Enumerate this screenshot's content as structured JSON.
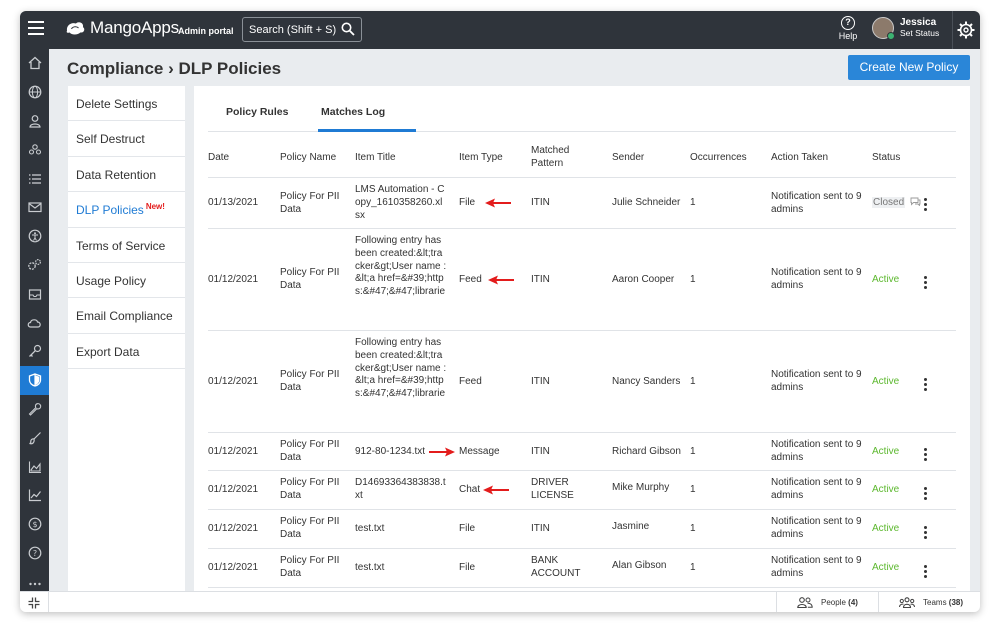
{
  "topbar": {
    "brand": "MangoApps",
    "portal_label": "Admin portal",
    "search_placeholder": "Search (Shift + S)",
    "help_label": "Help",
    "user_name": "Jessica",
    "user_status": "Set Status"
  },
  "rail": {
    "icons": [
      "home-icon",
      "globe-icon",
      "user-icon",
      "group-icon",
      "list-icon",
      "mail-icon",
      "accessibility-icon",
      "gears-icon",
      "inbox-icon",
      "cloud-icon",
      "key-icon",
      "shield-icon",
      "wrench-icon",
      "brush-icon",
      "chart-area-icon",
      "trend-icon",
      "dollar-icon",
      "help-circle-icon",
      "more-icon"
    ],
    "active_index": 11
  },
  "page": {
    "title": "Compliance › DLP Policies",
    "create_button": "Create New Policy"
  },
  "left_menu": {
    "items": [
      {
        "label": "Delete Settings"
      },
      {
        "label": "Self Destruct"
      },
      {
        "label": "Data Retention"
      },
      {
        "label": "DLP Policies",
        "badge": "New!"
      },
      {
        "label": "Terms of Service"
      },
      {
        "label": "Usage Policy"
      },
      {
        "label": "Email Compliance"
      },
      {
        "label": "Export Data"
      }
    ],
    "active_index": 3
  },
  "tabs": {
    "items": [
      "Policy Rules",
      "Matches Log"
    ],
    "active_index": 1
  },
  "table": {
    "headers": {
      "date": "Date",
      "policy": "Policy Name",
      "title": "Item Title",
      "type": "Item Type",
      "pattern": "Matched Pattern",
      "sender": "Sender",
      "occurrences": "Occurrences",
      "action": "Action Taken",
      "status": "Status"
    },
    "rows": [
      {
        "date": "01/13/2021",
        "policy": "Policy For PII Data",
        "title": "LMS Automation - Copy_1610358260.xlsx",
        "type": "File",
        "pattern": "ITIN",
        "sender": "Julie Schneider",
        "occurrences": "1",
        "action": "Notification sent to 9 admins",
        "status": "Closed"
      },
      {
        "date": "01/12/2021",
        "policy": "Policy For PII Data",
        "title": "Following entry has been created:&lt;tracker&gt;User name : &lt;a href=&#39;https:&#47;&#47;librarie",
        "type": "Feed",
        "pattern": "ITIN",
        "sender": "Aaron Cooper",
        "occurrences": "1",
        "action": "Notification sent to 9 admins",
        "status": "Active"
      },
      {
        "date": "01/12/2021",
        "policy": "Policy For PII Data",
        "title": "Following entry has been created:&lt;tracker&gt;User name : &lt;a href=&#39;https:&#47;&#47;librarie",
        "type": "Feed",
        "pattern": "ITIN",
        "sender": "Nancy Sanders",
        "occurrences": "1",
        "action": "Notification sent to 9 admins",
        "status": "Active"
      },
      {
        "date": "01/12/2021",
        "policy": "Policy For PII Data",
        "title": "912-80-1234.txt",
        "type": "Message",
        "pattern": "ITIN",
        "sender": "Richard Gibson",
        "occurrences": "1",
        "action": "Notification sent to 9 admins",
        "status": "Active"
      },
      {
        "date": "01/12/2021",
        "policy": "Policy For PII Data",
        "title": "D14693364383838.txt",
        "type": "Chat",
        "pattern": "DRIVER LICENSE",
        "sender": "Mike Murphy",
        "occurrences": "1",
        "action": "Notification sent to 9 admins",
        "status": "Active"
      },
      {
        "date": "01/12/2021",
        "policy": "Policy For PII Data",
        "title": "test.txt",
        "type": "File",
        "pattern": "ITIN",
        "sender": "Jasmine",
        "occurrences": "1",
        "action": "Notification sent to 9 admins",
        "status": "Active"
      },
      {
        "date": "01/12/2021",
        "policy": "Policy For PII Data",
        "title": "test.txt",
        "type": "File",
        "pattern": "BANK ACCOUNT",
        "sender": "Alan Gibson",
        "occurrences": "1",
        "action": "Notification sent to 9 admins",
        "status": "Active"
      }
    ]
  },
  "bottombar": {
    "people_label": "People",
    "people_count": "(4)",
    "teams_label": "Teams",
    "teams_count": "(38)"
  },
  "colors": {
    "accent": "#2a86d8",
    "topbar": "#2f343b",
    "active_status": "#5cb82e",
    "arrow": "#e31c1c"
  }
}
